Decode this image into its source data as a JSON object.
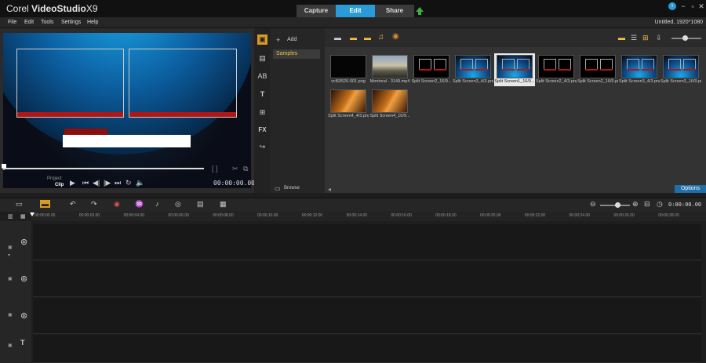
{
  "brand": {
    "prefix": "Corel",
    "name": "VideoStudio",
    "version": "X9"
  },
  "tabs": [
    {
      "label": "Capture",
      "active": false
    },
    {
      "label": "Edit",
      "active": true
    },
    {
      "label": "Share",
      "active": false
    }
  ],
  "menu": [
    "File",
    "Edit",
    "Tools",
    "Settings",
    "Help"
  ],
  "project_info": "Untitled, 1920*1080",
  "player": {
    "mode_project": "Project",
    "mode_clip": "Clip",
    "timecode": "00:00:00.00"
  },
  "library": {
    "add_label": "Add",
    "folder_selected": "Samples",
    "browse_label": "Browse",
    "options_label": "Options",
    "thumbnails": [
      {
        "label": "vcl60526-001.png",
        "style": "dark"
      },
      {
        "label": "Montreal - 3149.mp4",
        "style": "city"
      },
      {
        "label": "Split Screen2_16/9...",
        "style": "split"
      },
      {
        "label": "Split Screen3_4/3.png",
        "style": "earth"
      },
      {
        "label": "Split Screen1_16/9...",
        "style": "earth",
        "selected": true
      },
      {
        "label": "Split Screen2_4/3.png",
        "style": "split"
      },
      {
        "label": "Split Screen2_16/9.png",
        "style": "split"
      },
      {
        "label": "Split Screen3_4/3.png",
        "style": "earth"
      },
      {
        "label": "Split Screen3_16/9.png",
        "style": "earth"
      },
      {
        "label": "Split Screen4_4/3.png",
        "style": "orange"
      },
      {
        "label": "Split Screen4_16/9...",
        "style": "orange"
      }
    ]
  },
  "timeline": {
    "timecode": "0:00:00.00",
    "ruler": [
      "00:00:00.00",
      "00:00:02.00",
      "00:00:04.00",
      "00:00:06.00",
      "00:00:08.00",
      "00:00:10.00",
      "00:00:12.00",
      "00:00:14.00",
      "00:00:16.00",
      "00:00:18.00",
      "00:00:20.00",
      "00:00:22.00",
      "00:00:24.00",
      "00:00:26.00",
      "00:00:28.00"
    ]
  },
  "colors": {
    "accent": "#2a9bd6",
    "folder_text": "#f0c040",
    "upload": "#3fae3f"
  }
}
